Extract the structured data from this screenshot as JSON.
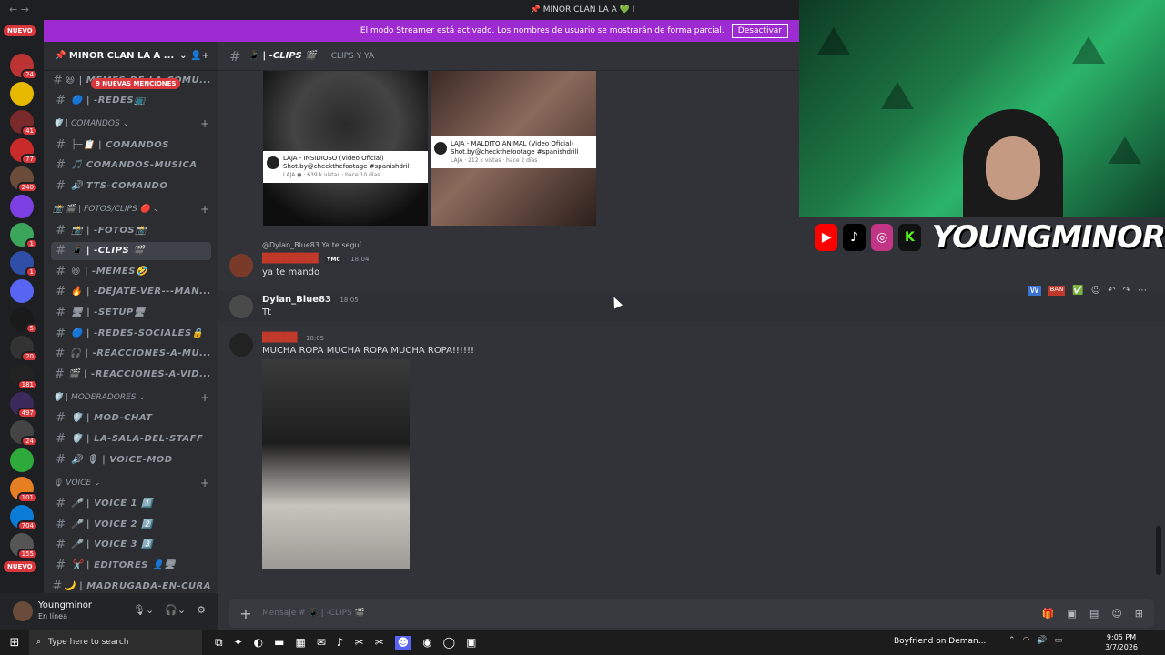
{
  "titlebar": {
    "title": "📌 MINOR CLAN LA A 💚 I"
  },
  "streamer": {
    "text": "El modo Streamer está activado. Los nombres de usuario se mostrarán de forma parcial.",
    "button": "Desactivar"
  },
  "servers": [
    {
      "badge": "NUEVO",
      "kind": "nuevo"
    },
    {
      "badge": "24"
    },
    {
      "badge": ""
    },
    {
      "badge": "41"
    },
    {
      "badge": "77"
    },
    {
      "badge": "240"
    },
    {
      "badge": ""
    },
    {
      "badge": "1"
    },
    {
      "badge": "1"
    },
    {
      "badge": ""
    },
    {
      "badge": "5"
    },
    {
      "badge": "20"
    },
    {
      "badge": "181"
    },
    {
      "badge": "497"
    },
    {
      "badge": "24"
    },
    {
      "badge": ""
    },
    {
      "badge": "101"
    },
    {
      "badge": "704"
    },
    {
      "badge": "155"
    },
    {
      "badge": "NUEVO",
      "kind": "nuevo"
    }
  ],
  "sidebar": {
    "guild_name": "📌 MINOR CLAN LA A ...",
    "mention_badge": "9 NUEVAS MENCIONES",
    "items": [
      {
        "type": "channel",
        "label": "😆 | MEMES-DE-LA-COMU..."
      },
      {
        "type": "channel",
        "label": "🔵 | -REDES📺"
      },
      {
        "type": "category",
        "label": "🛡️ | COMANDOS ⌄"
      },
      {
        "type": "channel",
        "label": "├─📋 | COMANDOS"
      },
      {
        "type": "channel",
        "label": "🎵 COMANDOS-MUSICA"
      },
      {
        "type": "channel",
        "label": "🔊 TTS-COMANDO"
      },
      {
        "type": "category",
        "label": "📸 🎬 | FOTOS/CLIPS 🔴 ⌄"
      },
      {
        "type": "channel",
        "label": "📸 | -FOTOS📸"
      },
      {
        "type": "channel",
        "label": "📱 | -CLIPS 🎬",
        "active": true
      },
      {
        "type": "channel",
        "label": "😆 | -MEMES🤣"
      },
      {
        "type": "channel",
        "label": "🔥 | -DEJATE-VER---MAN..."
      },
      {
        "type": "channel",
        "label": "🖥 | -SETUP🖥"
      },
      {
        "type": "channel",
        "label": "🔵 | -REDES-SOCIALES🔒"
      },
      {
        "type": "channel",
        "label": "🎧 | -REACCIONES-A-MU..."
      },
      {
        "type": "channel",
        "label": "🎬 | -REACCIONES-A-VID..."
      },
      {
        "type": "category",
        "label": "🛡️ | MODERADORES ⌄"
      },
      {
        "type": "channel",
        "label": "🛡️ | MOD-CHAT"
      },
      {
        "type": "channel",
        "label": "🛡️ | LA-SALA-DEL-STAFF"
      },
      {
        "type": "channel",
        "label": "🔊 🎙 | VOICE-MOD"
      },
      {
        "type": "category",
        "label": "🎙 VOICE ⌄"
      },
      {
        "type": "channel",
        "label": "🎤 | VOICE 1 1️⃣"
      },
      {
        "type": "channel",
        "label": "🎤 | VOICE 2 2️⃣"
      },
      {
        "type": "channel",
        "label": "🎤 | VOICE 3 3️⃣"
      },
      {
        "type": "channel",
        "label": "✂️ | EDITORES 👤🖥"
      },
      {
        "type": "channel",
        "label": "🌙 | MADRUGADA-EN-CURA"
      }
    ]
  },
  "user": {
    "name": "Youngminor",
    "status": "En línea"
  },
  "channel_header": {
    "name": "📱 | -CLIPS 🎬",
    "topic": "CLIPS Y YA"
  },
  "embeds": [
    {
      "title": "LAJA - INSIDIOSO (Video Oficial) Shot.by@checkthefootage #spanishdrill",
      "sub": "LAJA ● · 639 k vistas · hace 10 días"
    },
    {
      "title": "LAJA - MALDITO ANIMAL (Video Oficial) Shot.by@checkthefootage #spanishdrill",
      "sub": "LAJA · 212 k vistas · hace 2 días"
    }
  ],
  "messages": [
    {
      "reply": "@Dylan_Blue83 Ya te seguí",
      "author": "████████",
      "tag": "YMC",
      "time": "18:04",
      "text": "ya te mando"
    },
    {
      "author": "Dylan_Blue83",
      "time": "18:05",
      "text": "Tt"
    },
    {
      "author": "█████",
      "time": "18:05",
      "text": "MUCHA ROPA MUCHA ROPA MUCHA ROPA!!!!!!"
    }
  ],
  "composer": {
    "placeholder": "Mensaje # 📱 | -CLIPS 🎬"
  },
  "overlay": {
    "brand": "YOUNGMINOR"
  },
  "taskbar": {
    "search": "Type here to search",
    "media": "Boyfriend on Deman...",
    "time": "9:05 PM",
    "date": "3/7/2026"
  }
}
